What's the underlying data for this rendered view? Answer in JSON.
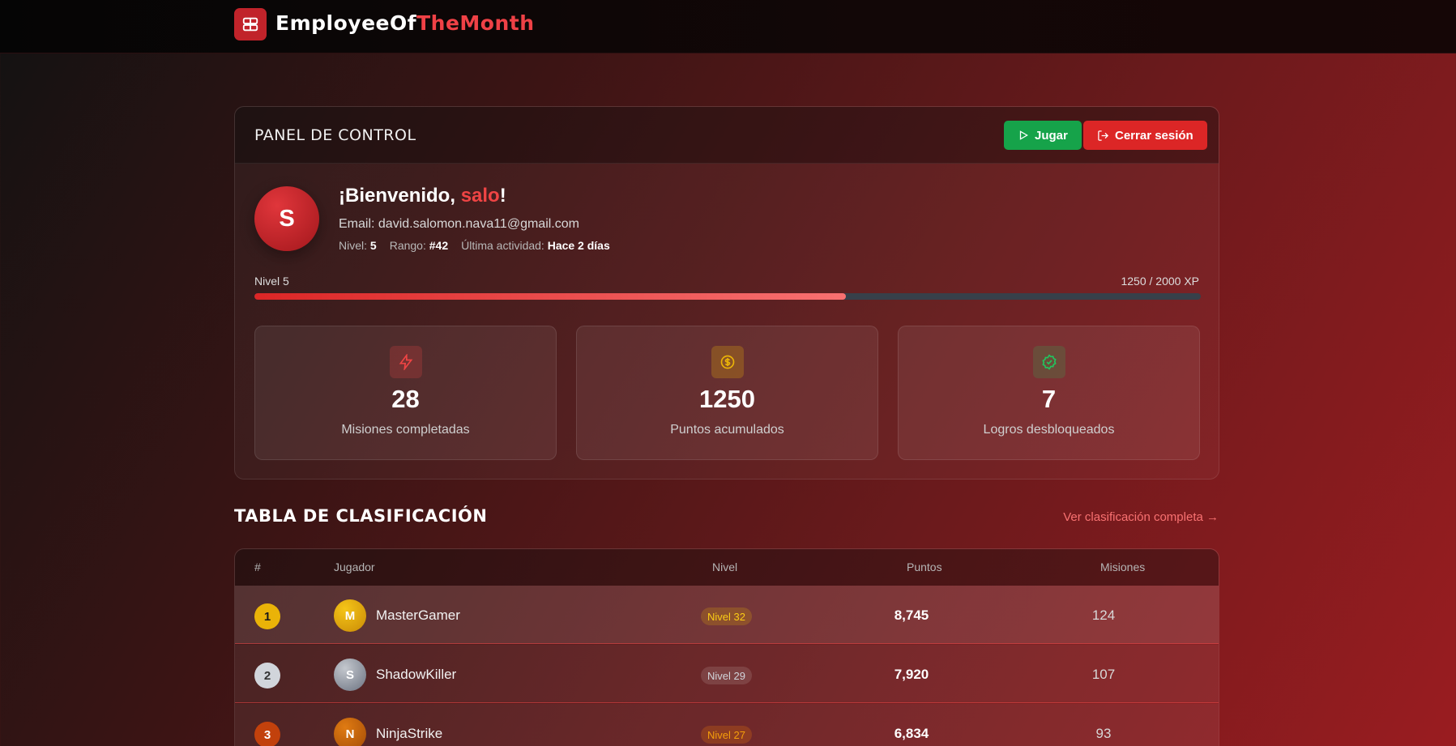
{
  "header": {
    "brand_part1": "EmployeeOf",
    "brand_part2": "TheMonth",
    "logo_icon": "dashboard-icon"
  },
  "panel": {
    "title": "PANEL DE CONTROL",
    "play_label": "Jugar",
    "logout_label": "Cerrar sesión"
  },
  "user": {
    "avatar_initial": "S",
    "welcome_prefix": "¡Bienvenido, ",
    "username": "salo",
    "welcome_suffix": "!",
    "email_text": "Email: david.salomon.nava11@gmail.com",
    "level_label": "Nivel:",
    "level_value": "5",
    "rank_label": "Rango:",
    "rank_value": "#42",
    "activity_label": "Última actividad:",
    "activity_value": "Hace 2 días"
  },
  "xp": {
    "level_text": "Nivel 5",
    "progress_text": "1250 / 2000 XP",
    "current": 1250,
    "max": 2000
  },
  "stats": [
    {
      "value": "28",
      "label": "Misiones completadas",
      "icon": "lightning-icon",
      "color": "#ef4444"
    },
    {
      "value": "1250",
      "label": "Puntos acumulados",
      "icon": "coin-icon",
      "color": "#eab308"
    },
    {
      "value": "7",
      "label": "Logros desbloqueados",
      "icon": "badge-check-icon",
      "color": "#22c55e"
    }
  ],
  "leaderboard": {
    "title": "TABLA DE CLASIFICACIÓN",
    "link_text": "Ver clasificación completa →",
    "columns": {
      "rank": "#",
      "player": "Jugador",
      "level": "Nivel",
      "points": "Puntos",
      "missions": "Misiones"
    },
    "rows": [
      {
        "rank": "1",
        "initial": "M",
        "name": "MasterGamer",
        "level": "Nivel 32",
        "points": "8,745",
        "missions": "124"
      },
      {
        "rank": "2",
        "initial": "S",
        "name": "ShadowKiller",
        "level": "Nivel 29",
        "points": "7,920",
        "missions": "107"
      },
      {
        "rank": "3",
        "initial": "N",
        "name": "NinjaStrike",
        "level": "Nivel 27",
        "points": "6,834",
        "missions": "93"
      }
    ]
  },
  "colors": {
    "accent": "#ef4444",
    "play": "#16a34a",
    "logout": "#dc2626",
    "gold": "#eab308",
    "silver": "#9ca3af",
    "bronze": "#c2410c"
  }
}
